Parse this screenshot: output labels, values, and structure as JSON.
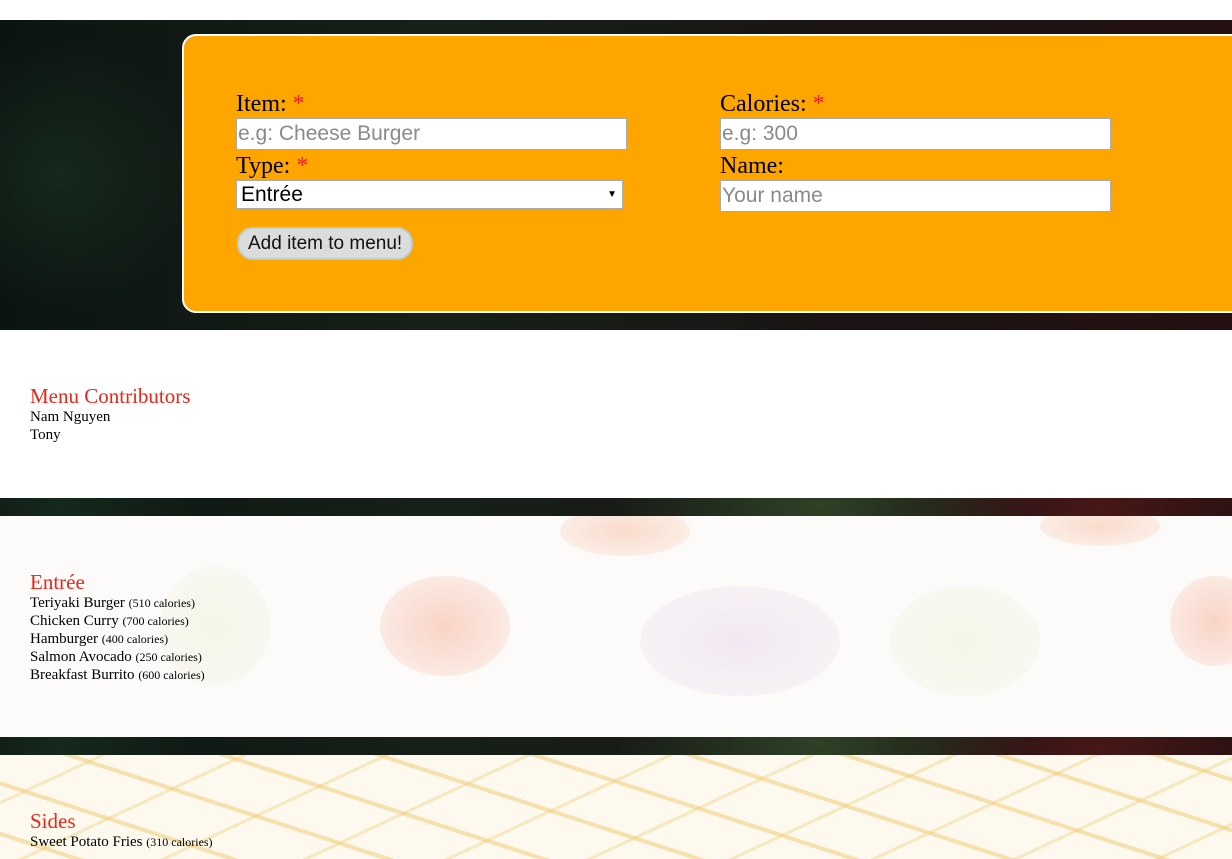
{
  "form": {
    "item_label": "Item:",
    "item_placeholder": "e.g: Cheese Burger",
    "calories_label": "Calories:",
    "calories_placeholder": "e.g: 300",
    "type_label": "Type:",
    "type_selected": "Entrée",
    "name_label": "Name:",
    "name_placeholder": "Your name",
    "required_marker": "*",
    "submit_label": "Add item to menu!"
  },
  "contributors": {
    "heading": "Menu Contributors",
    "names": [
      "Nam Nguyen",
      "Tony"
    ]
  },
  "entree": {
    "heading": "Entrée",
    "items": [
      {
        "name": "Teriyaki Burger",
        "calories": "(510 calories)"
      },
      {
        "name": "Chicken Curry",
        "calories": "(700 calories)"
      },
      {
        "name": "Hamburger",
        "calories": "(400 calories)"
      },
      {
        "name": "Salmon Avocado",
        "calories": "(250 calories)"
      },
      {
        "name": "Breakfast Burrito",
        "calories": "(600 calories)"
      }
    ]
  },
  "sides": {
    "heading": "Sides",
    "items": [
      {
        "name": "Sweet Potato Fries",
        "calories": "(310 calories)"
      }
    ]
  },
  "colors": {
    "form_background": "#ffa500",
    "heading_red": "#e8261a"
  }
}
